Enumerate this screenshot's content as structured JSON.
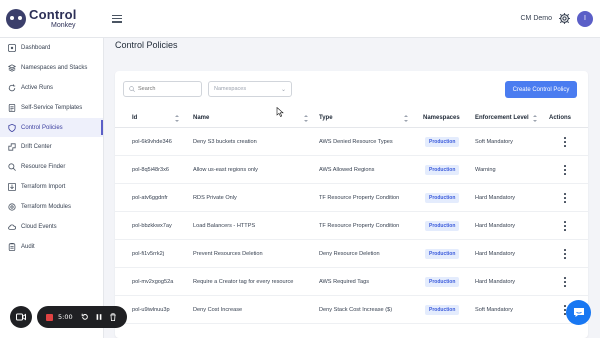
{
  "app": {
    "logo_title": "Control",
    "logo_subtitle": "Monkey",
    "env_name": "CM Demo",
    "avatar_initial": "I"
  },
  "sidebar": {
    "items": [
      {
        "label": "Dashboard",
        "icon": "dashboard-icon"
      },
      {
        "label": "Namespaces and Stacks",
        "icon": "layers-icon"
      },
      {
        "label": "Active Runs",
        "icon": "refresh-icon"
      },
      {
        "label": "Self-Service Templates",
        "icon": "document-icon"
      },
      {
        "label": "Control Policies",
        "icon": "shield-icon",
        "active": true
      },
      {
        "label": "Drift Center",
        "icon": "drift-icon"
      },
      {
        "label": "Resource Finder",
        "icon": "search-icon"
      },
      {
        "label": "Terraform Import",
        "icon": "import-icon"
      },
      {
        "label": "Terraform Modules",
        "icon": "modules-icon"
      },
      {
        "label": "Cloud Events",
        "icon": "cloud-icon"
      },
      {
        "label": "Audit",
        "icon": "audit-icon"
      }
    ]
  },
  "main": {
    "title": "Control Policies",
    "search_placeholder": "Search",
    "namespaces_placeholder": "Namespaces",
    "create_label": "Create Control Policy"
  },
  "table": {
    "headers": {
      "id": "Id",
      "name": "Name",
      "type": "Type",
      "namespaces": "Namespaces",
      "enforcement": "Enforcement Level",
      "actions": "Actions"
    },
    "rows": [
      {
        "id": "pol-6k9vhde346",
        "name": "Deny S3 buckets creation",
        "type": "AWS Denied Resource Types",
        "namespace": "Production",
        "enforcement": "Soft Mandatory"
      },
      {
        "id": "pol-8q5i48r3x6",
        "name": "Allow us-east regions only",
        "type": "AWS Allowed Regions",
        "namespace": "Production",
        "enforcement": "Warning"
      },
      {
        "id": "pol-atv6ggdnfr",
        "name": "RDS Private Only",
        "type": "TF Resource Property Condition",
        "namespace": "Production",
        "enforcement": "Hard Mandatory"
      },
      {
        "id": "pol-bbzkkwx7ay",
        "name": "Load Balancers - HTTPS",
        "type": "TF Resource Property Condition",
        "namespace": "Production",
        "enforcement": "Hard Mandatory"
      },
      {
        "id": "pol-fi1v5rrk2j",
        "name": "Prevent Resources Deletion",
        "type": "Deny Resource Deletion",
        "namespace": "Production",
        "enforcement": "Hard Mandatory"
      },
      {
        "id": "pol-mv2xgog52a",
        "name": "Require a Creator tag for every resource",
        "type": "AWS Required Tags",
        "namespace": "Production",
        "enforcement": "Hard Mandatory"
      },
      {
        "id": "pol-u9iwlnuu3p",
        "name": "Deny Cost Increase",
        "type": "Deny Stack Cost Increase ($)",
        "namespace": "Production",
        "enforcement": "Soft Mandatory"
      }
    ]
  },
  "recorder": {
    "time": "5:00"
  },
  "colors": {
    "accent": "#4a7cf0",
    "brand": "#2d3057",
    "record": "#e04343",
    "chat": "#1877f2"
  }
}
